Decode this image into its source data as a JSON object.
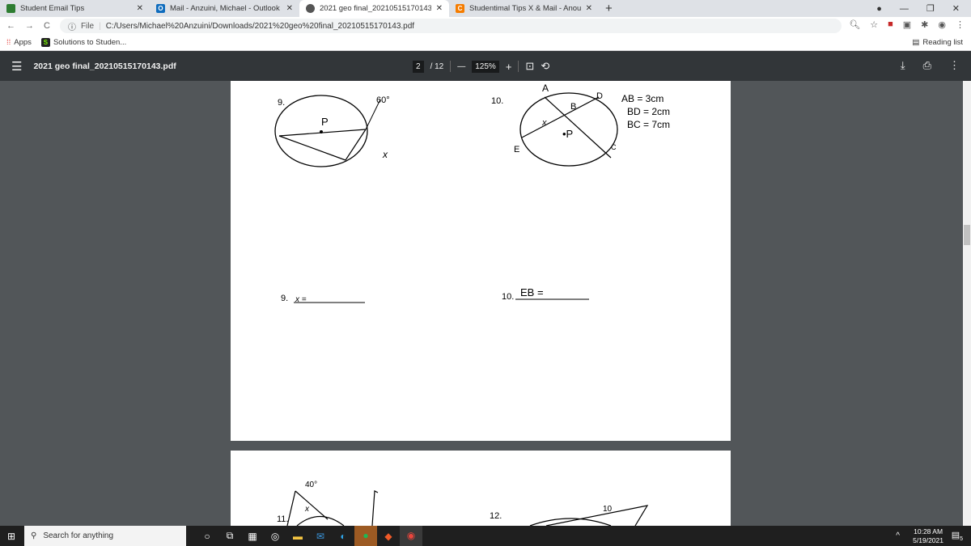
{
  "tabs": [
    {
      "title": "Student Email Tips",
      "icon": "green-logo-icon",
      "color": "#2e7d32"
    },
    {
      "title": "Mail - Anzuini, Michael - Outlook",
      "icon": "outlook-icon",
      "color": "#0f6cbd"
    },
    {
      "title": "2021 geo final_20210515170143.pdf",
      "icon": "globe-icon",
      "color": "#555555",
      "active": true
    },
    {
      "title": "Studentimal Tips X & Mail - Anou",
      "icon": "c-logo-icon",
      "color": "#f57c00"
    }
  ],
  "address": {
    "scheme": "File",
    "url": "C:/Users/Michael%20Anzuini/Downloads/2021%20geo%20final_20210515170143.pdf"
  },
  "bookmarks": {
    "apps": "Apps",
    "items": [
      "Solutions to Studen..."
    ],
    "reading_list": "Reading list"
  },
  "pdf": {
    "title": "2021 geo final_20210515170143.pdf",
    "page": "2",
    "total": "/ 12",
    "zoom": "125%"
  },
  "page1": {
    "q9": "9.",
    "q10": "10.",
    "given": [
      "AB = 3cm",
      "BD = 2cm",
      "BC = 7cm"
    ],
    "labels9": {
      "p": "P",
      "x": "x",
      "angle": "60°"
    },
    "labels10": {
      "a": "A",
      "b": "B",
      "d": "D",
      "e": "E",
      "c": "C",
      "x": "x",
      "p": "•P"
    },
    "ans9_num": "9.",
    "ans9": "x =",
    "ans10_num": "10.",
    "ans10": "EB ="
  },
  "page2": {
    "q11": "11.",
    "q12": "12.",
    "angle": "40°",
    "x": "x",
    "ten": "10"
  },
  "taskbar": {
    "search": "Search for anything",
    "time": "10:28 AM",
    "date": "5/19/2021",
    "notifications": "5"
  }
}
